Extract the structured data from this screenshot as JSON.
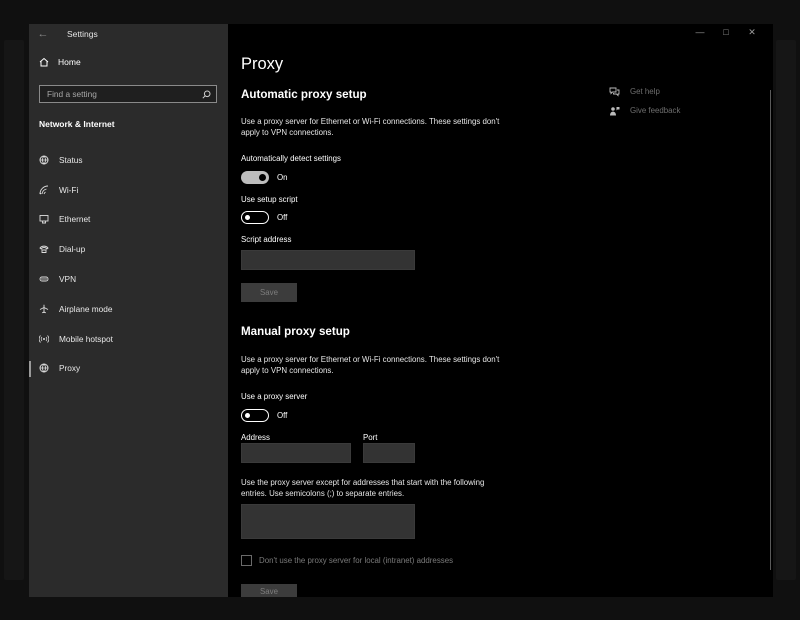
{
  "window": {
    "title": "Settings"
  },
  "sidebar": {
    "home_label": "Home",
    "search_placeholder": "Find a setting",
    "section_title": "Network & Internet",
    "items": [
      {
        "label": "Status",
        "icon": "globe-icon"
      },
      {
        "label": "Wi-Fi",
        "icon": "wifi-icon"
      },
      {
        "label": "Ethernet",
        "icon": "ethernet-icon"
      },
      {
        "label": "Dial-up",
        "icon": "dialup-icon"
      },
      {
        "label": "VPN",
        "icon": "vpn-icon"
      },
      {
        "label": "Airplane mode",
        "icon": "airplane-icon"
      },
      {
        "label": "Mobile hotspot",
        "icon": "hotspot-icon"
      },
      {
        "label": "Proxy",
        "icon": "globe-icon",
        "active": true
      }
    ]
  },
  "main": {
    "title": "Proxy",
    "auto": {
      "heading": "Automatic proxy setup",
      "description": "Use a proxy server for Ethernet or Wi-Fi connections. These settings don't apply to VPN connections.",
      "detect_label": "Automatically detect settings",
      "detect_state": "On",
      "script_label": "Use setup script",
      "script_state": "Off",
      "address_label": "Script address",
      "address_value": "",
      "save_label": "Save"
    },
    "manual": {
      "heading": "Manual proxy setup",
      "description": "Use a proxy server for Ethernet or Wi-Fi connections. These settings don't apply to VPN connections.",
      "use_proxy_label": "Use a proxy server",
      "use_proxy_state": "Off",
      "address_label": "Address",
      "address_value": "",
      "port_label": "Port",
      "port_value": "",
      "exceptions_description": "Use the proxy server except for addresses that start with the following entries. Use semicolons (;) to separate entries.",
      "exceptions_value": "",
      "local_checkbox_label": "Don't use the proxy server for local (intranet) addresses",
      "save_label": "Save"
    },
    "help": {
      "get_help": "Get help",
      "give_feedback": "Give feedback"
    }
  }
}
